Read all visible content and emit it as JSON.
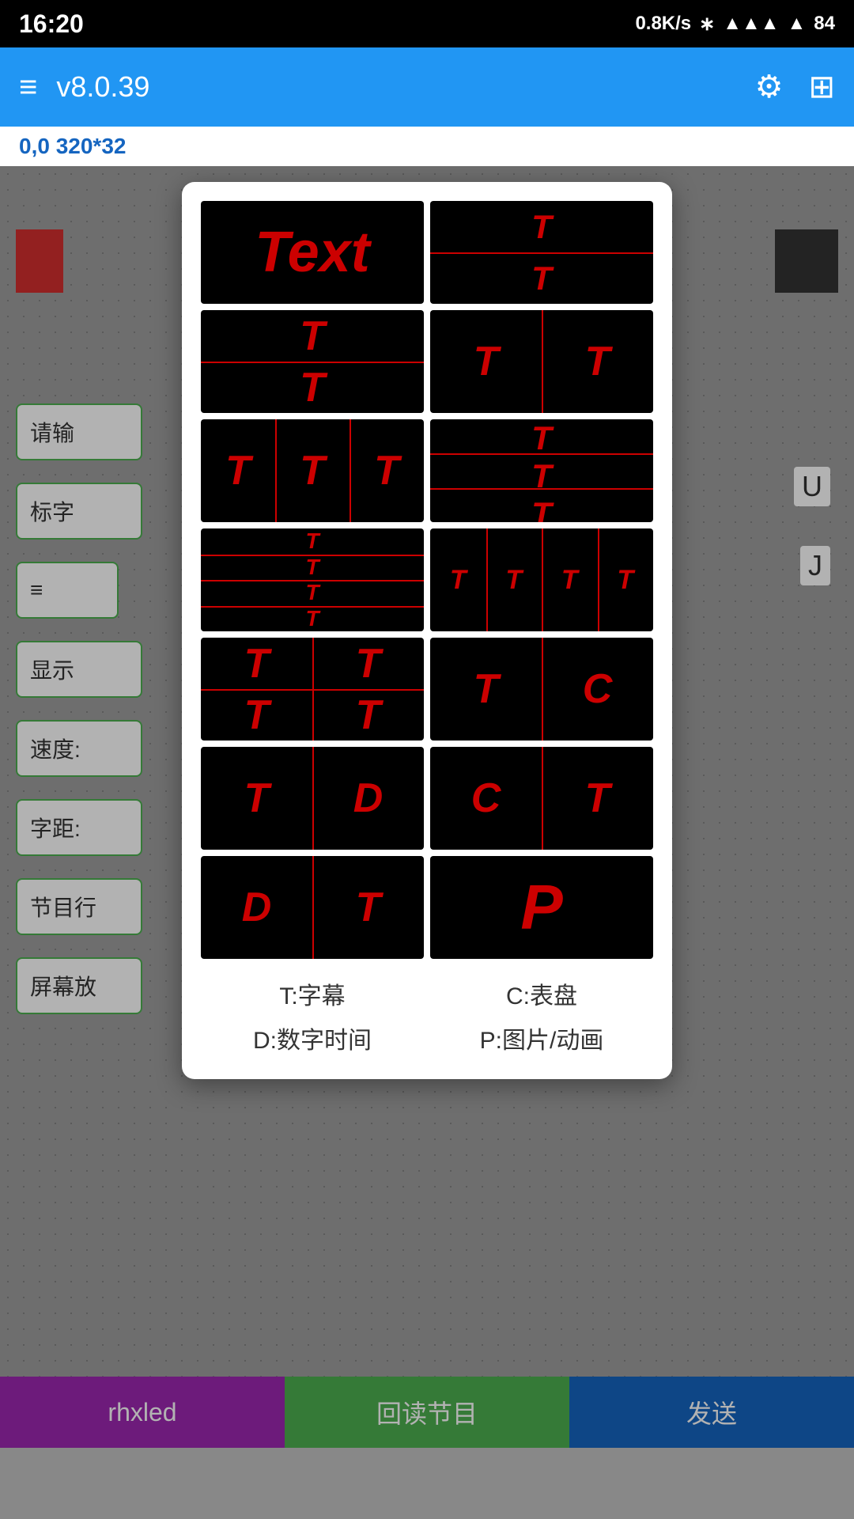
{
  "statusBar": {
    "time": "16:20",
    "network": "0.8K/s",
    "battery": "84"
  },
  "appBar": {
    "title": "v8.0.39",
    "menuIcon": "≡",
    "settingsIcon": "⚙",
    "gridIcon": "⊞"
  },
  "coordLabel": "0,0 320*32",
  "bottomBar": {
    "rhxledLabel": "rhxled",
    "readLabel": "回读节目",
    "sendLabel": "发送"
  },
  "modal": {
    "cells": [
      {
        "id": "cell-1",
        "layout": "text-only",
        "letters": [
          "Text"
        ]
      },
      {
        "id": "cell-2",
        "layout": "top-T-bottom-T",
        "letters": [
          "T",
          "T"
        ]
      },
      {
        "id": "cell-3",
        "layout": "two-row-TT",
        "letters": [
          "T",
          "T"
        ]
      },
      {
        "id": "cell-4",
        "layout": "two-col-TT",
        "letters": [
          "T",
          "T"
        ]
      },
      {
        "id": "cell-5",
        "layout": "three-col-TTT",
        "letters": [
          "T",
          "T",
          "T"
        ]
      },
      {
        "id": "cell-6",
        "layout": "three-row-TTT",
        "letters": [
          "T",
          "T",
          "T"
        ]
      },
      {
        "id": "cell-7",
        "layout": "four-row-TTTT",
        "letters": [
          "T",
          "T",
          "T",
          "T"
        ]
      },
      {
        "id": "cell-8",
        "layout": "four-col-TTTT",
        "letters": [
          "T",
          "T",
          "T",
          "T"
        ]
      },
      {
        "id": "cell-9",
        "layout": "two-two-TTTT",
        "letters": [
          "T",
          "T",
          "T",
          "T"
        ]
      },
      {
        "id": "cell-10",
        "layout": "two-col-TC",
        "letters": [
          "T",
          "C"
        ]
      },
      {
        "id": "cell-11",
        "layout": "two-col-TD",
        "letters": [
          "T",
          "D"
        ]
      },
      {
        "id": "cell-12",
        "layout": "two-col-CT",
        "letters": [
          "C",
          "T"
        ]
      },
      {
        "id": "cell-13",
        "layout": "two-col-DT",
        "letters": [
          "D",
          "T"
        ]
      },
      {
        "id": "cell-14",
        "layout": "single-P",
        "letters": [
          "P"
        ]
      }
    ],
    "legend": [
      {
        "key": "T",
        "label": "T:字幕"
      },
      {
        "key": "C",
        "label": "C:表盘"
      },
      {
        "key": "D",
        "label": "D:数字时间"
      },
      {
        "key": "P",
        "label": "P:图片/动画"
      }
    ]
  },
  "background": {
    "inputPlaceholders": [
      "请输",
      "标字",
      "显示",
      "速度:",
      "字距:",
      "节目行",
      "屏幕放"
    ],
    "labels": [
      "U",
      "J"
    ]
  }
}
